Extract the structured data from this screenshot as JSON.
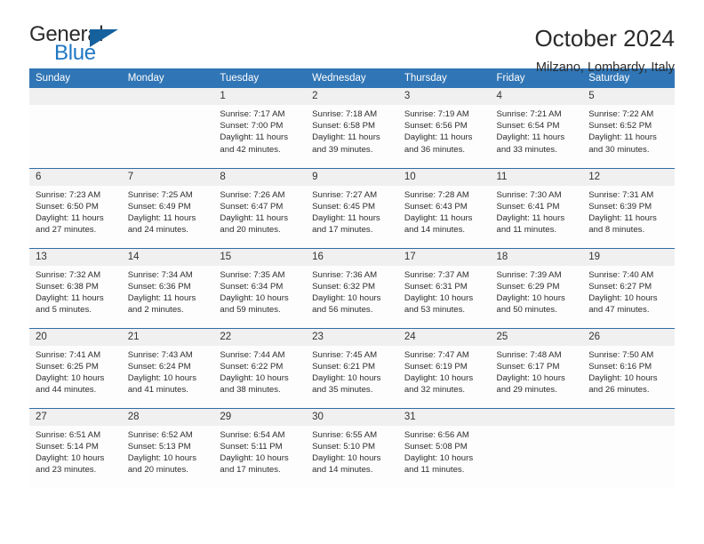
{
  "brand": {
    "word_one": "General",
    "word_two": "Blue",
    "logo_icon": "blue-triangle-logo",
    "accent_color": "#1f77c4"
  },
  "header": {
    "title": "October 2024",
    "subtitle": "Milzano, Lombardy, Italy"
  },
  "theme": {
    "header_row_bg": "#3075b5",
    "week_divider": "#2e6da4",
    "daynum_bg": "#f0f0f0",
    "cell_bg": "#fdfdfd",
    "text": "#2d2d2d"
  },
  "columns": [
    "Sunday",
    "Monday",
    "Tuesday",
    "Wednesday",
    "Thursday",
    "Friday",
    "Saturday"
  ],
  "labels": {
    "sunrise": "Sunrise:",
    "sunset": "Sunset:",
    "daylight": "Daylight:"
  },
  "weeks": [
    [
      {
        "day": ""
      },
      {
        "day": ""
      },
      {
        "day": "1",
        "sunrise": "Sunrise: 7:17 AM",
        "sunset": "Sunset: 7:00 PM",
        "daylight1": "Daylight: 11 hours",
        "daylight2": "and 42 minutes."
      },
      {
        "day": "2",
        "sunrise": "Sunrise: 7:18 AM",
        "sunset": "Sunset: 6:58 PM",
        "daylight1": "Daylight: 11 hours",
        "daylight2": "and 39 minutes."
      },
      {
        "day": "3",
        "sunrise": "Sunrise: 7:19 AM",
        "sunset": "Sunset: 6:56 PM",
        "daylight1": "Daylight: 11 hours",
        "daylight2": "and 36 minutes."
      },
      {
        "day": "4",
        "sunrise": "Sunrise: 7:21 AM",
        "sunset": "Sunset: 6:54 PM",
        "daylight1": "Daylight: 11 hours",
        "daylight2": "and 33 minutes."
      },
      {
        "day": "5",
        "sunrise": "Sunrise: 7:22 AM",
        "sunset": "Sunset: 6:52 PM",
        "daylight1": "Daylight: 11 hours",
        "daylight2": "and 30 minutes."
      }
    ],
    [
      {
        "day": "6",
        "sunrise": "Sunrise: 7:23 AM",
        "sunset": "Sunset: 6:50 PM",
        "daylight1": "Daylight: 11 hours",
        "daylight2": "and 27 minutes."
      },
      {
        "day": "7",
        "sunrise": "Sunrise: 7:25 AM",
        "sunset": "Sunset: 6:49 PM",
        "daylight1": "Daylight: 11 hours",
        "daylight2": "and 24 minutes."
      },
      {
        "day": "8",
        "sunrise": "Sunrise: 7:26 AM",
        "sunset": "Sunset: 6:47 PM",
        "daylight1": "Daylight: 11 hours",
        "daylight2": "and 20 minutes."
      },
      {
        "day": "9",
        "sunrise": "Sunrise: 7:27 AM",
        "sunset": "Sunset: 6:45 PM",
        "daylight1": "Daylight: 11 hours",
        "daylight2": "and 17 minutes."
      },
      {
        "day": "10",
        "sunrise": "Sunrise: 7:28 AM",
        "sunset": "Sunset: 6:43 PM",
        "daylight1": "Daylight: 11 hours",
        "daylight2": "and 14 minutes."
      },
      {
        "day": "11",
        "sunrise": "Sunrise: 7:30 AM",
        "sunset": "Sunset: 6:41 PM",
        "daylight1": "Daylight: 11 hours",
        "daylight2": "and 11 minutes."
      },
      {
        "day": "12",
        "sunrise": "Sunrise: 7:31 AM",
        "sunset": "Sunset: 6:39 PM",
        "daylight1": "Daylight: 11 hours",
        "daylight2": "and 8 minutes."
      }
    ],
    [
      {
        "day": "13",
        "sunrise": "Sunrise: 7:32 AM",
        "sunset": "Sunset: 6:38 PM",
        "daylight1": "Daylight: 11 hours",
        "daylight2": "and 5 minutes."
      },
      {
        "day": "14",
        "sunrise": "Sunrise: 7:34 AM",
        "sunset": "Sunset: 6:36 PM",
        "daylight1": "Daylight: 11 hours",
        "daylight2": "and 2 minutes."
      },
      {
        "day": "15",
        "sunrise": "Sunrise: 7:35 AM",
        "sunset": "Sunset: 6:34 PM",
        "daylight1": "Daylight: 10 hours",
        "daylight2": "and 59 minutes."
      },
      {
        "day": "16",
        "sunrise": "Sunrise: 7:36 AM",
        "sunset": "Sunset: 6:32 PM",
        "daylight1": "Daylight: 10 hours",
        "daylight2": "and 56 minutes."
      },
      {
        "day": "17",
        "sunrise": "Sunrise: 7:37 AM",
        "sunset": "Sunset: 6:31 PM",
        "daylight1": "Daylight: 10 hours",
        "daylight2": "and 53 minutes."
      },
      {
        "day": "18",
        "sunrise": "Sunrise: 7:39 AM",
        "sunset": "Sunset: 6:29 PM",
        "daylight1": "Daylight: 10 hours",
        "daylight2": "and 50 minutes."
      },
      {
        "day": "19",
        "sunrise": "Sunrise: 7:40 AM",
        "sunset": "Sunset: 6:27 PM",
        "daylight1": "Daylight: 10 hours",
        "daylight2": "and 47 minutes."
      }
    ],
    [
      {
        "day": "20",
        "sunrise": "Sunrise: 7:41 AM",
        "sunset": "Sunset: 6:25 PM",
        "daylight1": "Daylight: 10 hours",
        "daylight2": "and 44 minutes."
      },
      {
        "day": "21",
        "sunrise": "Sunrise: 7:43 AM",
        "sunset": "Sunset: 6:24 PM",
        "daylight1": "Daylight: 10 hours",
        "daylight2": "and 41 minutes."
      },
      {
        "day": "22",
        "sunrise": "Sunrise: 7:44 AM",
        "sunset": "Sunset: 6:22 PM",
        "daylight1": "Daylight: 10 hours",
        "daylight2": "and 38 minutes."
      },
      {
        "day": "23",
        "sunrise": "Sunrise: 7:45 AM",
        "sunset": "Sunset: 6:21 PM",
        "daylight1": "Daylight: 10 hours",
        "daylight2": "and 35 minutes."
      },
      {
        "day": "24",
        "sunrise": "Sunrise: 7:47 AM",
        "sunset": "Sunset: 6:19 PM",
        "daylight1": "Daylight: 10 hours",
        "daylight2": "and 32 minutes."
      },
      {
        "day": "25",
        "sunrise": "Sunrise: 7:48 AM",
        "sunset": "Sunset: 6:17 PM",
        "daylight1": "Daylight: 10 hours",
        "daylight2": "and 29 minutes."
      },
      {
        "day": "26",
        "sunrise": "Sunrise: 7:50 AM",
        "sunset": "Sunset: 6:16 PM",
        "daylight1": "Daylight: 10 hours",
        "daylight2": "and 26 minutes."
      }
    ],
    [
      {
        "day": "27",
        "sunrise": "Sunrise: 6:51 AM",
        "sunset": "Sunset: 5:14 PM",
        "daylight1": "Daylight: 10 hours",
        "daylight2": "and 23 minutes."
      },
      {
        "day": "28",
        "sunrise": "Sunrise: 6:52 AM",
        "sunset": "Sunset: 5:13 PM",
        "daylight1": "Daylight: 10 hours",
        "daylight2": "and 20 minutes."
      },
      {
        "day": "29",
        "sunrise": "Sunrise: 6:54 AM",
        "sunset": "Sunset: 5:11 PM",
        "daylight1": "Daylight: 10 hours",
        "daylight2": "and 17 minutes."
      },
      {
        "day": "30",
        "sunrise": "Sunrise: 6:55 AM",
        "sunset": "Sunset: 5:10 PM",
        "daylight1": "Daylight: 10 hours",
        "daylight2": "and 14 minutes."
      },
      {
        "day": "31",
        "sunrise": "Sunrise: 6:56 AM",
        "sunset": "Sunset: 5:08 PM",
        "daylight1": "Daylight: 10 hours",
        "daylight2": "and 11 minutes."
      },
      {
        "day": ""
      },
      {
        "day": ""
      }
    ]
  ]
}
